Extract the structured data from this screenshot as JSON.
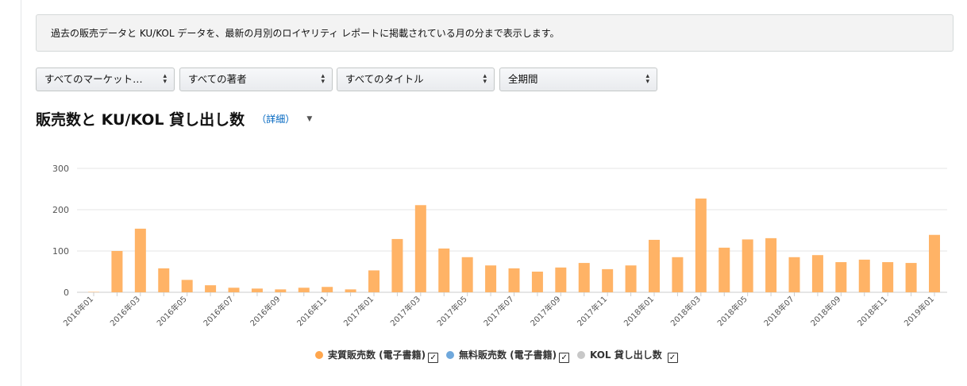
{
  "notice": {
    "text": "過去の販売データと KU/KOL データを、最新の月別のロイヤリティ レポートに掲載されている月の分まで表示します。"
  },
  "filters": [
    {
      "label": "すべてのマーケット…"
    },
    {
      "label": "すべての著者"
    },
    {
      "label": "すべてのタイトル"
    },
    {
      "label": "全期間"
    }
  ],
  "chart_header": {
    "title": "販売数と KU/KOL 貸し出し数",
    "detail_link": "（詳細）"
  },
  "legend": [
    {
      "label": "実質販売数 (電子書籍)",
      "color": "#ffa64d"
    },
    {
      "label": "無料販売数 (電子書籍)",
      "color": "#6fa8dc"
    },
    {
      "label": "KOL 貸し出し数",
      "color": "#c8c8c8"
    }
  ],
  "chart_data": {
    "type": "bar",
    "x": [
      "2016年01",
      "2016年02",
      "2016年03",
      "2016年04",
      "2016年05",
      "2016年06",
      "2016年07",
      "2016年08",
      "2016年09",
      "2016年10",
      "2016年11",
      "2016年12",
      "2017年01",
      "2017年02",
      "2017年03",
      "2017年04",
      "2017年05",
      "2017年06",
      "2017年07",
      "2017年08",
      "2017年09",
      "2017年10",
      "2017年11",
      "2017年12",
      "2018年01",
      "2018年02",
      "2018年03",
      "2018年04",
      "2018年05",
      "2018年06",
      "2018年07",
      "2018年08",
      "2018年09",
      "2018年10",
      "2018年11",
      "2018年12",
      "2019年01"
    ],
    "xtick_labels": [
      "2016年01",
      "2016年03",
      "2016年05",
      "2016年07",
      "2016年09",
      "2016年11",
      "2017年01",
      "2017年03",
      "2017年05",
      "2017年07",
      "2017年09",
      "2017年11",
      "2018年01",
      "2018年03",
      "2018年05",
      "2018年07",
      "2018年09",
      "2018年11",
      "2019年01"
    ],
    "series": [
      {
        "name": "実質販売数 (電子書籍)",
        "color": "#ffb366",
        "values": [
          1,
          100,
          154,
          58,
          30,
          17,
          11,
          9,
          7,
          11,
          13,
          7,
          53,
          129,
          211,
          106,
          85,
          65,
          58,
          50,
          60,
          71,
          56,
          65,
          127,
          85,
          227,
          108,
          128,
          131,
          85,
          90,
          73,
          79,
          73,
          71,
          139
        ]
      }
    ],
    "yticks": [
      0,
      100,
      200,
      300
    ],
    "ylim": [
      0,
      300
    ],
    "grid": true,
    "legend_position": "bottom"
  }
}
